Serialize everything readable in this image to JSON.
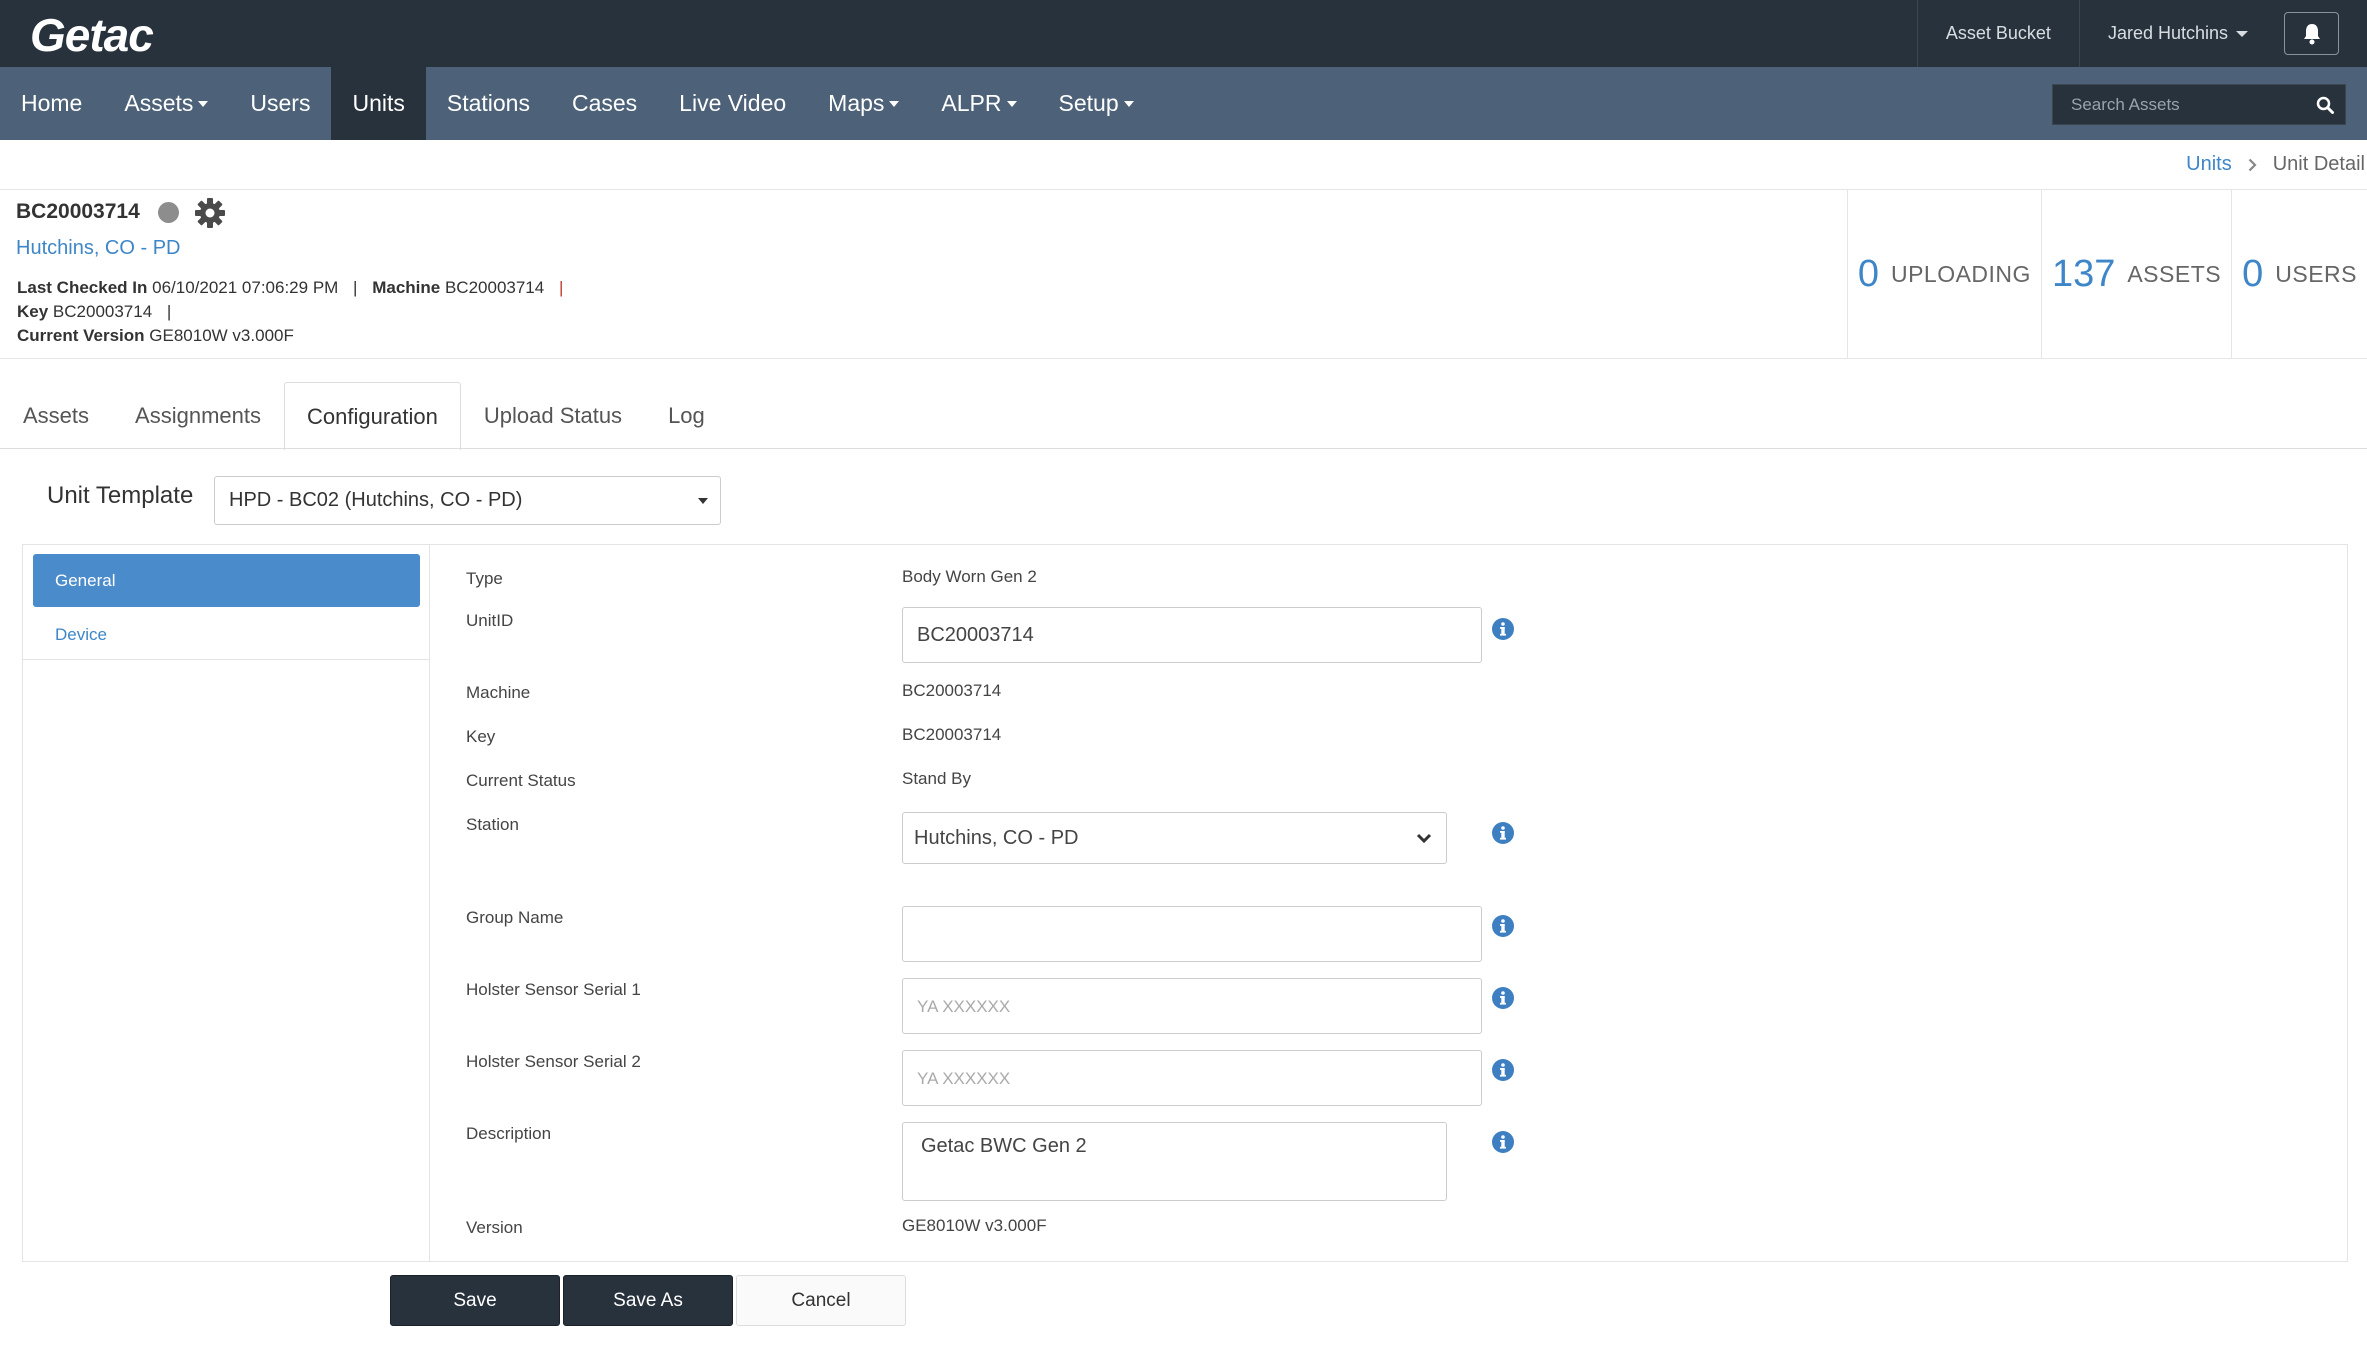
{
  "topbar": {
    "logo": "Getac",
    "asset_bucket": "Asset Bucket",
    "user_name": "Jared Hutchins"
  },
  "nav": {
    "items": [
      {
        "label": "Home",
        "dropdown": false
      },
      {
        "label": "Assets",
        "dropdown": true
      },
      {
        "label": "Users",
        "dropdown": false
      },
      {
        "label": "Units",
        "dropdown": false,
        "active": true
      },
      {
        "label": "Stations",
        "dropdown": false
      },
      {
        "label": "Cases",
        "dropdown": false
      },
      {
        "label": "Live Video",
        "dropdown": false
      },
      {
        "label": "Maps",
        "dropdown": true
      },
      {
        "label": "ALPR",
        "dropdown": true
      },
      {
        "label": "Setup",
        "dropdown": true
      }
    ],
    "search_placeholder": "Search Assets"
  },
  "breadcrumb": {
    "parent": "Units",
    "current": "Unit Detail"
  },
  "unit": {
    "id": "BC20003714",
    "station": "Hutchins, CO - PD",
    "last_checked_in_label": "Last Checked In",
    "last_checked_in_value": "06/10/2021 07:06:29 PM",
    "machine_label": "Machine",
    "machine_value": "BC20003714",
    "key_label": "Key",
    "key_value": "BC20003714",
    "version_label": "Current Version",
    "version_value": "GE8010W v3.000F",
    "separator": "|"
  },
  "stats": [
    {
      "num": "0",
      "label": "UPLOADING"
    },
    {
      "num": "137",
      "label": "ASSETS"
    },
    {
      "num": "0",
      "label": "USERS"
    }
  ],
  "tabs": [
    {
      "label": "Assets"
    },
    {
      "label": "Assignments"
    },
    {
      "label": "Configuration",
      "active": true
    },
    {
      "label": "Upload Status"
    },
    {
      "label": "Log"
    }
  ],
  "template": {
    "label": "Unit Template",
    "value": "HPD - BC02 (Hutchins, CO - PD)"
  },
  "left_nav": {
    "general": "General",
    "device": "Device"
  },
  "form": {
    "type_label": "Type",
    "type_value": "Body Worn Gen 2",
    "unitid_label": "UnitID",
    "unitid_value": "BC20003714",
    "machine_label": "Machine",
    "machine_value": "BC20003714",
    "key_label": "Key",
    "key_value": "BC20003714",
    "status_label": "Current Status",
    "status_value": "Stand By",
    "station_label": "Station",
    "station_value": "Hutchins, CO - PD",
    "group_label": "Group Name",
    "group_value": "",
    "holster1_label": "Holster Sensor Serial 1",
    "holster1_placeholder": "YA XXXXXX",
    "holster2_label": "Holster Sensor Serial 2",
    "holster2_placeholder": "YA XXXXXX",
    "description_label": "Description",
    "description_value": "Getac BWC Gen 2",
    "version_label": "Version",
    "version_value": "GE8010W v3.000F"
  },
  "buttons": {
    "save": "Save",
    "save_as": "Save As",
    "cancel": "Cancel"
  },
  "colors": {
    "topbar": "#28323c",
    "navbar": "#4d6278",
    "accent": "#3e86c8",
    "active_nav": "#4a8bcb",
    "status_dot": "#8d8d8d"
  }
}
